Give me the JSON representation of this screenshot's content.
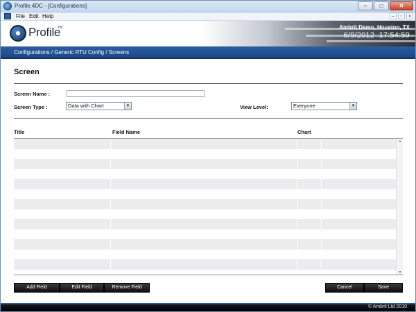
{
  "window": {
    "title": "Profile.4DC - [Configurations]",
    "controls": {
      "minimize": "–",
      "maximize": "□",
      "close": "✕"
    }
  },
  "menubar": {
    "items": [
      "File",
      "Edit",
      "Help"
    ],
    "mdi_controls": {
      "minimize": "–",
      "restore": "▫",
      "close": "x"
    }
  },
  "header": {
    "logo_text": "Profile",
    "logo_tm": "TM",
    "company": "Ambrit Demo, Houston, TX",
    "date": "6/9/2012",
    "time": "17:54:59"
  },
  "breadcrumb": "Configurations / Generic RTU Config / Screens",
  "form": {
    "section_title": "Screen",
    "screen_name_label": "Screen Name :",
    "screen_name_value": "",
    "screen_type_label": "Screen Type :",
    "screen_type_value": "Data with Chart",
    "view_level_label": "View Level:",
    "view_level_value": "Everyone"
  },
  "table": {
    "columns": [
      "Title",
      "Field Name",
      "Chart"
    ],
    "rows": []
  },
  "buttons": {
    "add_field": "Add Field",
    "edit_field": "Edit Field",
    "remove_field": "Remove Field",
    "cancel": "Cancel",
    "save": "Save"
  },
  "footer": {
    "copyright": "© Ambrit Ltd 2010"
  },
  "colors": {
    "accent": "#1f4f95",
    "footer": "#000000"
  },
  "icons": {
    "dropdown": "chevron-down-icon",
    "app": "profile-app-icon",
    "logo": "profile-logo-icon"
  }
}
